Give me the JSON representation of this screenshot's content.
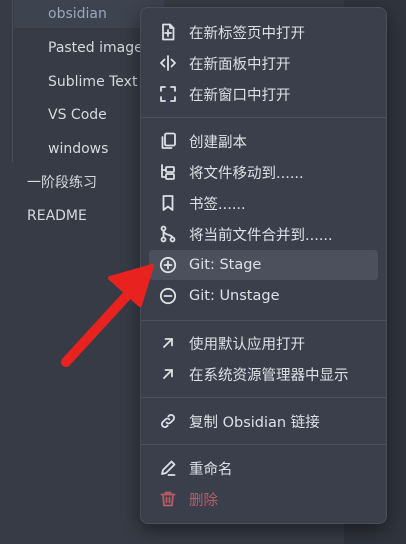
{
  "file_tree": {
    "items": [
      {
        "label": "obsidian",
        "active": true
      },
      {
        "label": "Pasted image"
      },
      {
        "label": "Sublime Text"
      },
      {
        "label": "VS Code"
      },
      {
        "label": "windows"
      },
      {
        "label": "一阶段练习"
      },
      {
        "label": "README"
      }
    ]
  },
  "context_menu": {
    "items": [
      {
        "label": "在新标签页中打开",
        "icon": "new-tab-icon"
      },
      {
        "label": "在新面板中打开",
        "icon": "split-pane-icon"
      },
      {
        "label": "在新窗口中打开",
        "icon": "new-window-icon"
      },
      {
        "label": "创建副本",
        "icon": "copy-icon"
      },
      {
        "label": "将文件移动到......",
        "icon": "move-folder-icon"
      },
      {
        "label": "书签......",
        "icon": "bookmark-icon"
      },
      {
        "label": "将当前文件合并到......",
        "icon": "git-merge-icon"
      },
      {
        "label": "Git: Stage",
        "icon": "plus-circle-icon",
        "highlighted": true
      },
      {
        "label": "Git: Unstage",
        "icon": "minus-circle-icon"
      },
      {
        "label": "使用默认应用打开",
        "icon": "external-arrow-icon"
      },
      {
        "label": "在系统资源管理器中显示",
        "icon": "external-arrow-icon"
      },
      {
        "label": "复制 Obsidian 链接",
        "icon": "link-icon"
      },
      {
        "label": "重命名",
        "icon": "pencil-icon"
      },
      {
        "label": "删除",
        "icon": "trash-icon",
        "danger": true
      }
    ]
  },
  "colors": {
    "background": "#363a44",
    "menu_background": "#3b3f4b",
    "highlight": "#4b505c",
    "danger": "#b85d66",
    "annotation_arrow": "#e8231f"
  }
}
